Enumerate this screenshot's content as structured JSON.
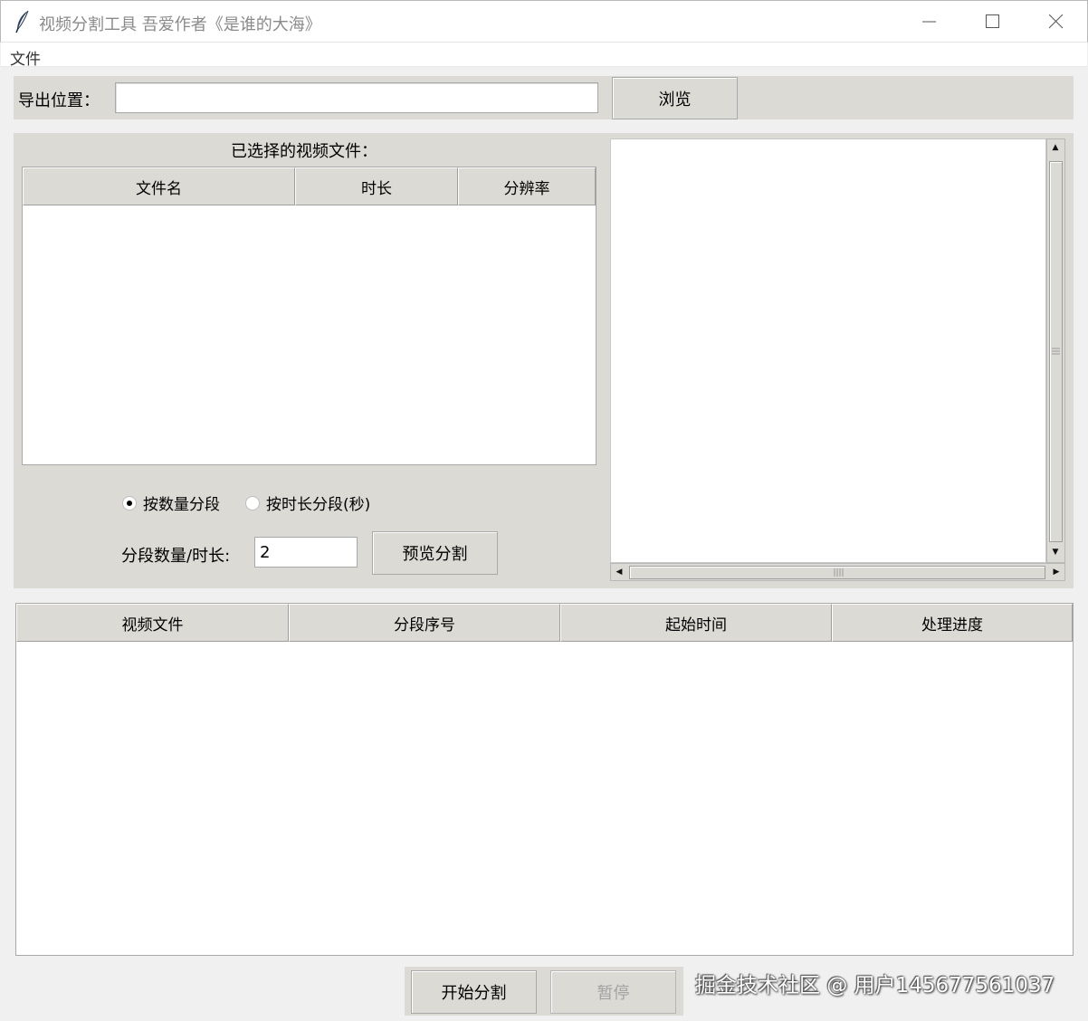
{
  "window": {
    "title": "视频分割工具 吾爱作者《是谁的大海》"
  },
  "menu": {
    "file": "文件"
  },
  "export": {
    "label": "导出位置：",
    "value": "",
    "browse_label": "浏览"
  },
  "selection": {
    "label": "已选择的视频文件：",
    "columns": [
      "文件名",
      "时长",
      "分辨率"
    ],
    "rows": []
  },
  "mode": {
    "by_count_label": "按数量分段",
    "by_duration_label": "按时长分段(秒)",
    "selected": "by_count"
  },
  "segment": {
    "label": "分段数量/时长:",
    "value": "2",
    "preview_label": "预览分割"
  },
  "preview": {
    "text": ""
  },
  "segments_table": {
    "columns": [
      "视频文件",
      "分段序号",
      "起始时间",
      "处理进度"
    ],
    "rows": []
  },
  "actions": {
    "start_label": "开始分割",
    "pause_label": "暂停"
  },
  "watermark": "掘金技术社区 @ 用户145677561037"
}
